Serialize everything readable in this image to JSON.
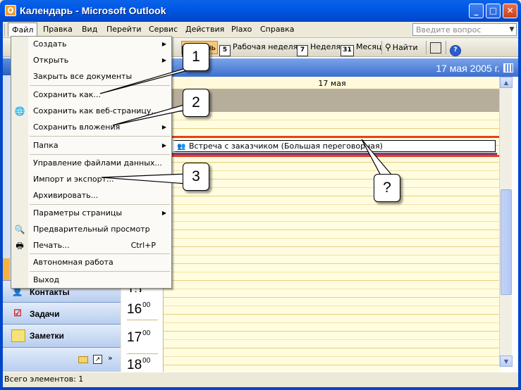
{
  "window": {
    "title": "Календарь - Microsoft Outlook",
    "controls": {
      "minimize": "_",
      "maximize": "□",
      "close": "✕"
    }
  },
  "menubar": {
    "items": [
      "Файл",
      "Правка",
      "Вид",
      "Перейти",
      "Сервис",
      "Действия",
      "Plaxo",
      "Справка"
    ],
    "help_placeholder": "Введите вопрос"
  },
  "toolbar": {
    "day_icon": "1",
    "day_label": "День",
    "workweek_icon": "5",
    "workweek_label": "Рабочая неделя",
    "week_icon": "7",
    "week_label": "Неделя",
    "month_icon": "31",
    "month_label": "Месяц",
    "find_label": "Найти",
    "help_icon": "?"
  },
  "navigation": {
    "contacts": "Контакты",
    "tasks": "Задачи",
    "notes": "Заметки"
  },
  "calendar": {
    "header_date": "17 мая 2005 г.",
    "day_label": "17 мая",
    "hours": [
      {
        "hour": "15",
        "min": "00"
      },
      {
        "hour": "16",
        "min": "00"
      },
      {
        "hour": "17",
        "min": "00"
      },
      {
        "hour": "18",
        "min": "00"
      }
    ],
    "appointment": "Встреча с заказчиком (Большая переговорная)"
  },
  "file_menu": {
    "items": [
      {
        "label": "Создать",
        "submenu": true
      },
      {
        "label": "Открыть",
        "submenu": true
      },
      {
        "label": "Закрыть все документы"
      },
      {
        "label": "Сохранить как..."
      },
      {
        "label": "Сохранить как веб-страницу..."
      },
      {
        "label": "Сохранить вложения",
        "submenu": true
      },
      {
        "label": "Папка",
        "submenu": true
      },
      {
        "label": "Управление файлами данных..."
      },
      {
        "label": "Импорт и экспорт..."
      },
      {
        "label": "Архивировать..."
      },
      {
        "label": "Параметры страницы",
        "submenu": true
      },
      {
        "label": "Предварительный просмотр"
      },
      {
        "label": "Печать...",
        "shortcut": "Ctrl+P"
      },
      {
        "label": "Автономная работа"
      },
      {
        "label": "Выход"
      }
    ]
  },
  "callouts": [
    "1",
    "2",
    "3",
    "?"
  ],
  "status": {
    "text": "Всего элементов: 1"
  },
  "colors": {
    "title_bar": "#0058e6",
    "highlight": "#e8401c",
    "slot_bg": "#fffce0"
  }
}
